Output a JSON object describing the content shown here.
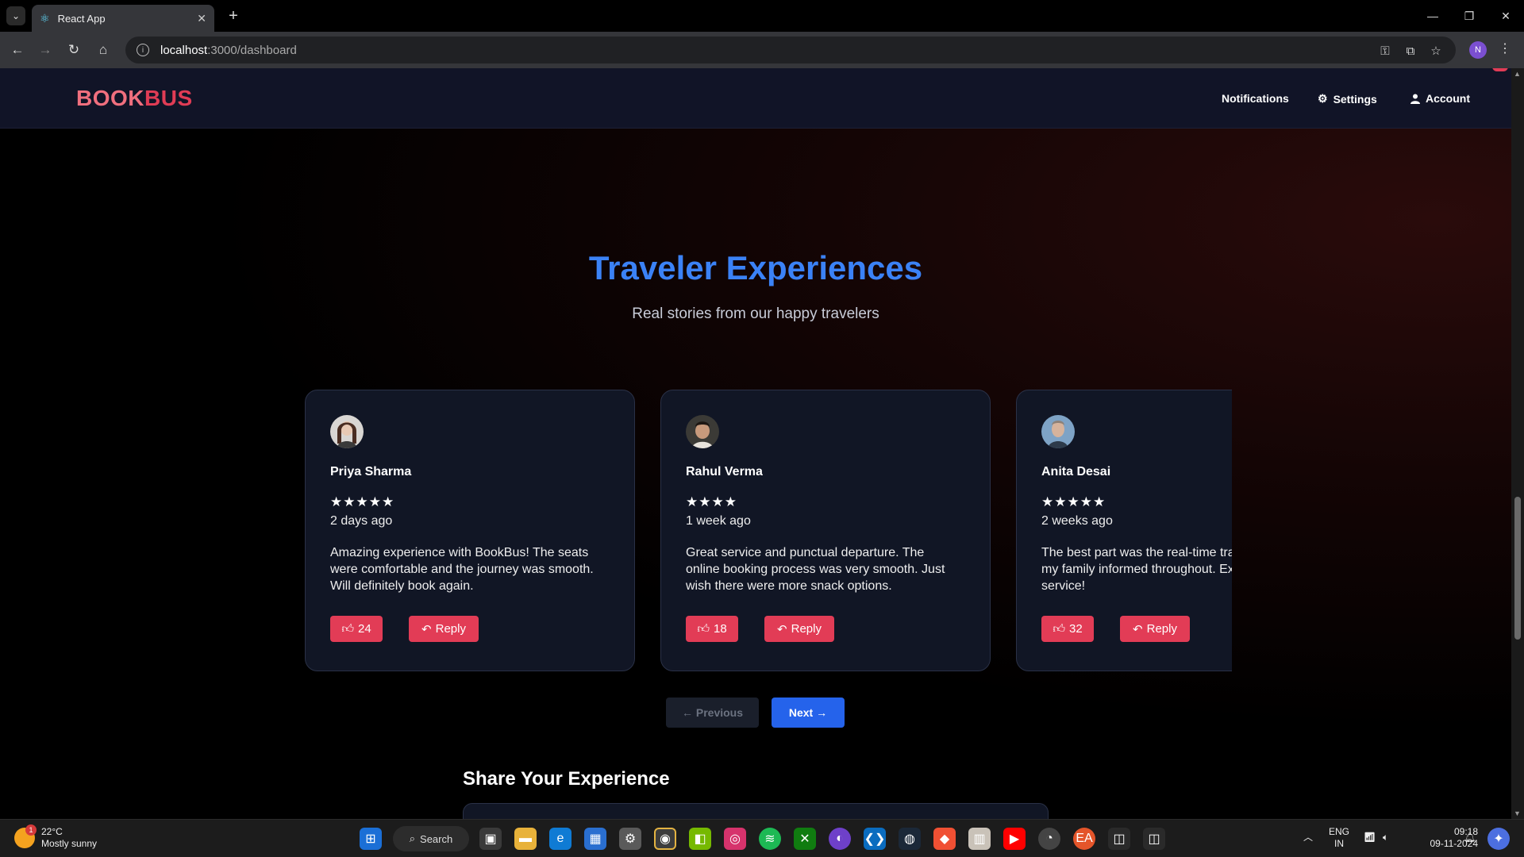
{
  "browser": {
    "tab_title": "React App",
    "url_host": "localhost",
    "url_path": ":3000/dashboard",
    "profile_initial": "N"
  },
  "navbar": {
    "logo_part1": "BOOK",
    "logo_part2": "BUS",
    "notifications": "Notifications",
    "settings": "Settings",
    "account": "Account"
  },
  "section": {
    "title": "Traveler Experiences",
    "subtitle": "Real stories from our happy travelers"
  },
  "reviews": [
    {
      "name": "Priya Sharma",
      "stars": "★★★★★",
      "when": "2 days ago",
      "text": "Amazing experience with BookBus! The seats were comfortable and the journey was smooth. Will definitely book again.",
      "likes": "24",
      "reply": "Reply"
    },
    {
      "name": "Rahul Verma",
      "stars": "★★★★",
      "when": "1 week ago",
      "text": "Great service and punctual departure. The online booking process was very smooth. Just wish there were more snack options.",
      "likes": "18",
      "reply": "Reply"
    },
    {
      "name": "Anita Desai",
      "stars": "★★★★★",
      "when": "2 weeks ago",
      "text": "The best part was the real-time tracking. Kept my family informed throughout. Excellent service!",
      "likes": "32",
      "reply": "Reply"
    }
  ],
  "pager": {
    "prev": "← Previous",
    "next": "Next →"
  },
  "share": {
    "title": "Share Your Experience"
  },
  "taskbar": {
    "temp": "22°C",
    "weather": "Mostly sunny",
    "weather_badge": "1",
    "search": "Search",
    "lang1": "ENG",
    "lang2": "IN",
    "time": "09:18",
    "date": "09-11-2024"
  }
}
